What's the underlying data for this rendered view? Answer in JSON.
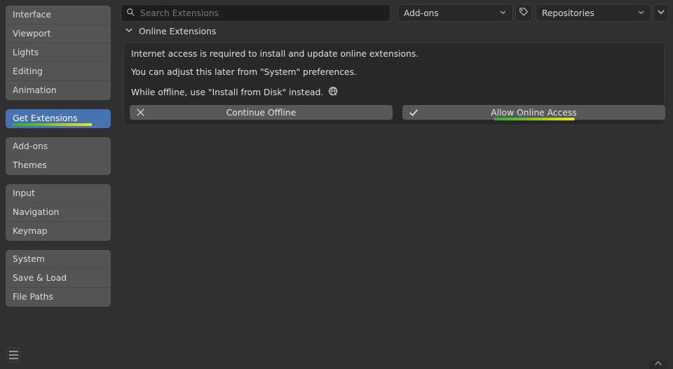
{
  "sidebar": {
    "groups": [
      {
        "items": [
          {
            "label": "Interface",
            "active": false
          },
          {
            "label": "Viewport",
            "active": false
          },
          {
            "label": "Lights",
            "active": false
          },
          {
            "label": "Editing",
            "active": false
          },
          {
            "label": "Animation",
            "active": false
          }
        ]
      },
      {
        "items": [
          {
            "label": "Get Extensions",
            "active": true
          }
        ]
      },
      {
        "items": [
          {
            "label": "Add-ons",
            "active": false
          },
          {
            "label": "Themes",
            "active": false
          }
        ]
      },
      {
        "items": [
          {
            "label": "Input",
            "active": false
          },
          {
            "label": "Navigation",
            "active": false
          },
          {
            "label": "Keymap",
            "active": false
          }
        ]
      },
      {
        "items": [
          {
            "label": "System",
            "active": false
          },
          {
            "label": "Save & Load",
            "active": false
          },
          {
            "label": "File Paths",
            "active": false
          }
        ]
      }
    ]
  },
  "topbar": {
    "search": {
      "value": "",
      "placeholder": "Search Extensions",
      "icon": "search-icon"
    },
    "filter_dropdown": {
      "value": "Add-ons",
      "icon": "chevron-down-icon"
    },
    "tag_button": {
      "icon": "tag-icon"
    },
    "repositories_dropdown": {
      "value": "Repositories",
      "icon": "chevron-down-icon"
    },
    "extra_dropdown": {
      "icon": "chevron-down-icon"
    }
  },
  "section": {
    "title": "Online Extensions",
    "collapse_icon": "chevron-down-icon"
  },
  "panel": {
    "lines": [
      "Internet access is required to install and update online extensions.",
      "You can adjust this later from \"System\" preferences.",
      "While offline, use \"Install from Disk\" instead."
    ],
    "inline_icon": "globe-cursor-icon",
    "buttons": [
      {
        "label": "Continue Offline",
        "icon": "close-x-icon",
        "highlighted": false
      },
      {
        "label": "Allow Online Access",
        "icon": "check-icon",
        "highlighted": true
      }
    ]
  },
  "statusbar": {
    "menu_button_icon": "hamburger-menu-icon",
    "resize_grip_icon": "chevron-up-icon"
  },
  "colors": {
    "accent_blue": "#4772b3",
    "gradient_start": "#33aa33",
    "gradient_end": "#e9e424",
    "window_bg": "#303030",
    "panel_bg": "#282828",
    "nav_bg": "#545454"
  }
}
